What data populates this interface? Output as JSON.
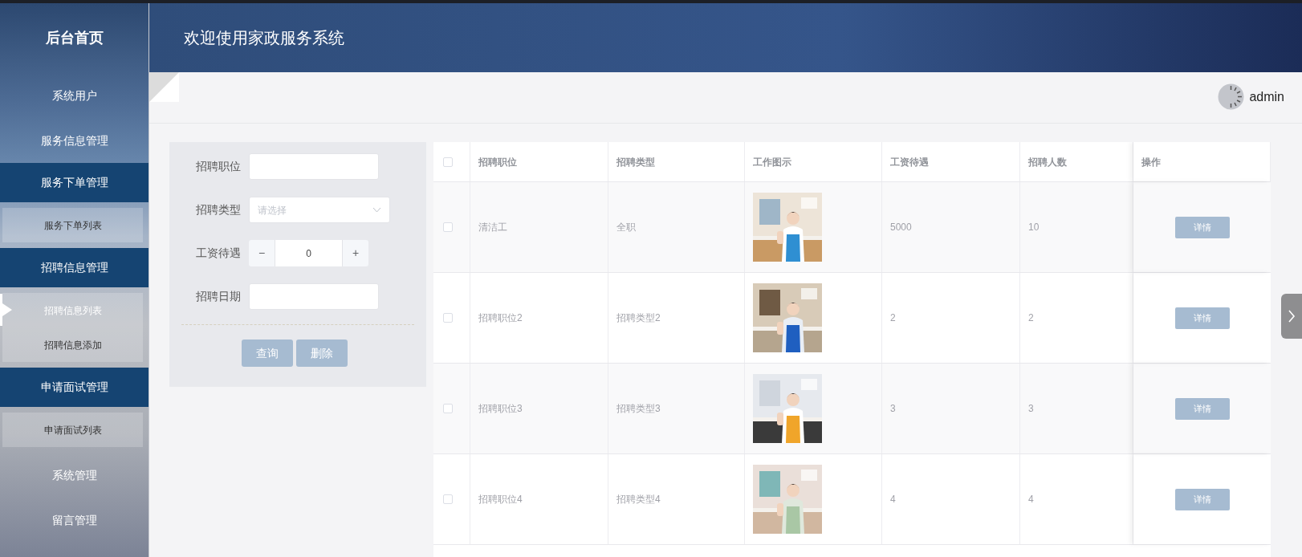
{
  "sidebar": {
    "title": "后台首页",
    "items": [
      {
        "kind": "link",
        "label": "系统用户"
      },
      {
        "kind": "link",
        "label": "服务信息管理"
      },
      {
        "kind": "group",
        "label": "服务下单管理",
        "children": [
          {
            "label": "服务下单列表",
            "selected": false
          }
        ]
      },
      {
        "kind": "group",
        "label": "招聘信息管理",
        "children": [
          {
            "label": "招聘信息列表",
            "selected": true
          },
          {
            "label": "招聘信息添加",
            "selected": false
          }
        ]
      },
      {
        "kind": "group",
        "label": "申请面试管理",
        "children": [
          {
            "label": "申请面试列表",
            "selected": false
          }
        ]
      },
      {
        "kind": "link",
        "label": "系统管理"
      },
      {
        "kind": "link",
        "label": "留言管理"
      }
    ]
  },
  "header": {
    "title": "欢迎使用家政服务系统"
  },
  "user": {
    "name": "admin"
  },
  "search_form": {
    "fields": [
      {
        "kind": "text",
        "label": "招聘职位"
      },
      {
        "kind": "select",
        "label": "招聘类型",
        "placeholder": "请选择"
      },
      {
        "kind": "number",
        "label": "工资待遇",
        "value": "0",
        "minus": "−",
        "plus": "+"
      },
      {
        "kind": "text",
        "label": "招聘日期"
      }
    ],
    "buttons": [
      "查询",
      "删除"
    ]
  },
  "table": {
    "select_all_checked": false,
    "columns": [
      "招聘职位",
      "招聘类型",
      "工作图示",
      "工资待遇",
      "招聘人数",
      "操作"
    ],
    "rows": [
      {
        "checked": false,
        "position": "清洁工",
        "type": "全职",
        "salary": "5000",
        "headcount": "10",
        "action": "详情"
      },
      {
        "checked": false,
        "position": "招聘职位2",
        "type": "招聘类型2",
        "salary": "2",
        "headcount": "2",
        "action": "详情"
      },
      {
        "checked": false,
        "position": "招聘职位3",
        "type": "招聘类型3",
        "salary": "3",
        "headcount": "3",
        "action": "详情"
      },
      {
        "checked": false,
        "position": "招聘职位4",
        "type": "招聘类型4",
        "salary": "4",
        "headcount": "4",
        "action": "详情"
      }
    ]
  }
}
